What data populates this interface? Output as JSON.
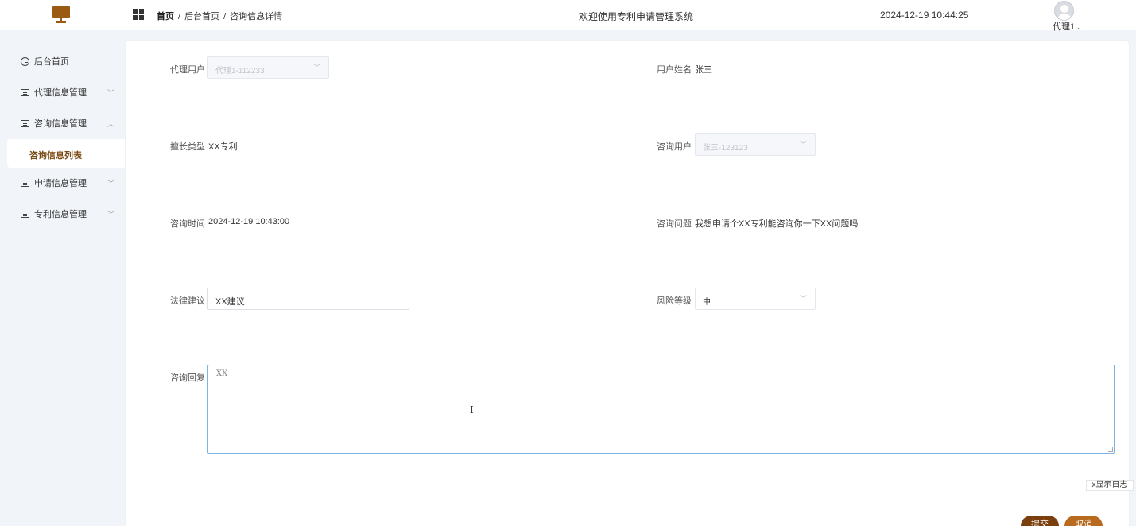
{
  "header": {
    "breadcrumb": [
      "首页",
      "后台首页",
      "咨询信息详情"
    ],
    "breadcrumb_sep": "/",
    "title": "欢迎使用专利申请管理系统",
    "datetime": "2024-12-19 10:44:25",
    "user": "代理1"
  },
  "sidebar": {
    "items": [
      {
        "label": "后台首页",
        "icon": "clock-icon"
      },
      {
        "label": "代理信息管理",
        "icon": "card-icon",
        "chevron": "﹀"
      },
      {
        "label": "咨询信息管理",
        "icon": "card-icon",
        "chevron": "︿"
      },
      {
        "label": "申请信息管理",
        "icon": "card-icon",
        "chevron": "﹀"
      },
      {
        "label": "专利信息管理",
        "icon": "card-icon",
        "chevron": "﹀"
      }
    ],
    "active_sub": "咨询信息列表"
  },
  "form": {
    "agent_user": {
      "label": "代理用户",
      "value": "代理1-112233"
    },
    "user_name": {
      "label": "用户姓名",
      "value": "张三"
    },
    "specialty_type": {
      "label": "擅长类型",
      "value": "XX专利"
    },
    "consult_user": {
      "label": "咨询用户",
      "value": "张三-123123"
    },
    "consult_time": {
      "label": "咨询时间",
      "value": "2024-12-19 10:43:00"
    },
    "consult_question": {
      "label": "咨询问题",
      "value": "我想申请个XX专利能咨询你一下XX问题吗"
    },
    "legal_advice": {
      "label": "法律建议",
      "value": "XX建议"
    },
    "risk_level": {
      "label": "风险等级",
      "value": "中"
    },
    "consult_reply": {
      "label": "咨询回复",
      "value": "XX"
    }
  },
  "buttons": {
    "show_log": "x显示日志",
    "submit": "提交",
    "cancel": "取消"
  },
  "colors": {
    "brand": "#9a5a12",
    "active_text": "#7a4a14",
    "submit_bg": "#7a3f0c",
    "cancel_bg": "#b86a1e",
    "textarea_focus": "#7fb2e5"
  }
}
